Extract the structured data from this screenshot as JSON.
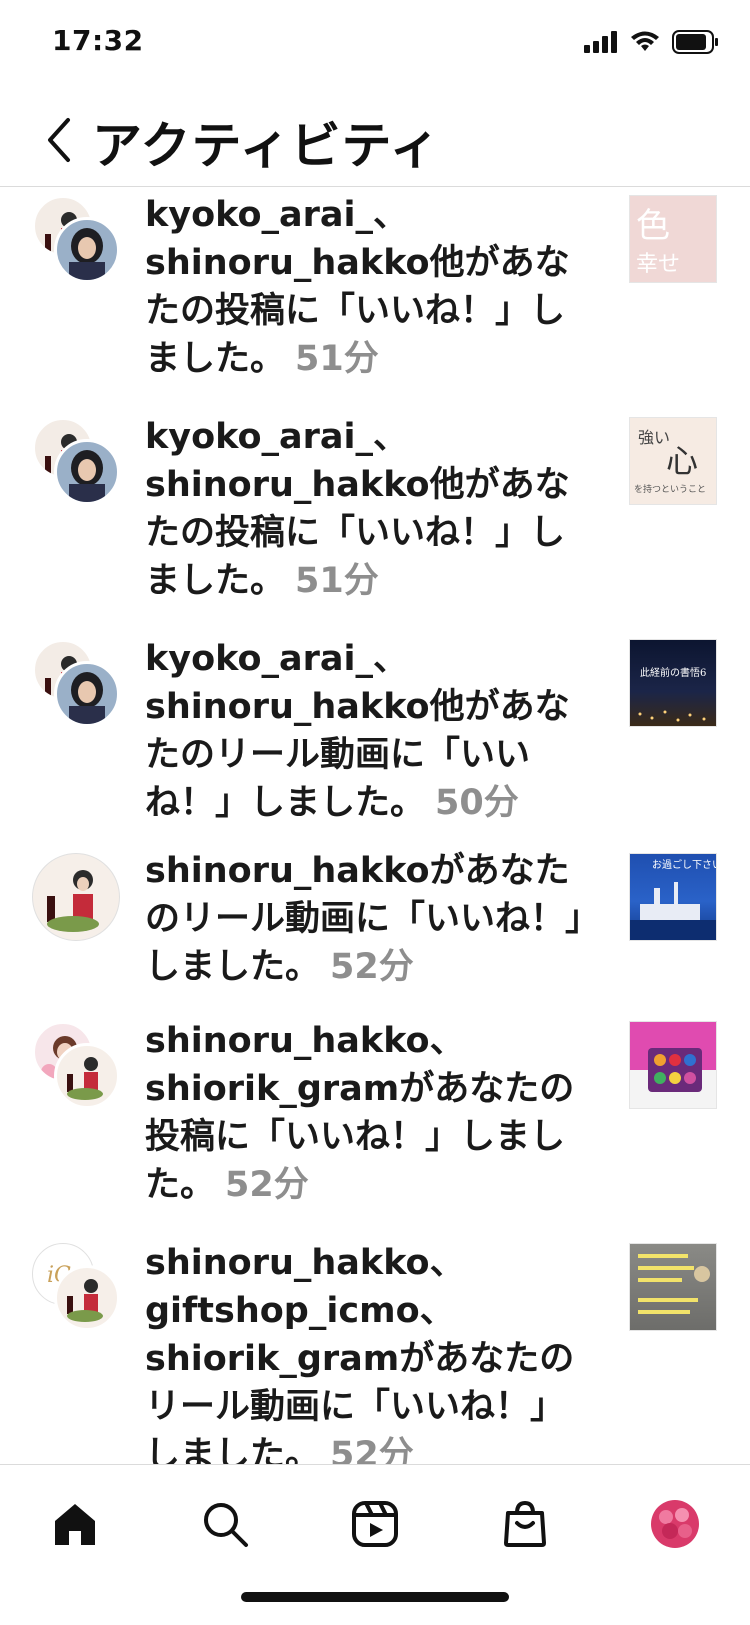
{
  "status": {
    "time": "17:32"
  },
  "header": {
    "title": "アクティビティ",
    "back_icon": "chevron-left-icon"
  },
  "notifications": [
    {
      "usernames": "kyoko_arai_、 shinoru_hakko",
      "message": "他があなたの投稿に「いいね！」しました。",
      "time": "51分",
      "thumb": {
        "line1": "色",
        "line2": "幸せ"
      }
    },
    {
      "usernames": "kyoko_arai_、 shinoru_hakko",
      "message": "他があなたの投稿に「いいね！」しました。",
      "time": "51分",
      "thumb": {
        "line1": "強い",
        "line2": "心",
        "line3": "を持つということ"
      }
    },
    {
      "usernames": "kyoko_arai_、 shinoru_hakko",
      "message": "他があなたのリール動画に「いいね！」しました。",
      "time": "50分",
      "thumb": {
        "line1": "此経前の書悟6"
      }
    },
    {
      "usernames": "shinoru_hakko",
      "message": "があなたのリール動画に「いいね！」しました。",
      "time": "52分",
      "thumb": {
        "line1": "お過ごし下さい"
      }
    },
    {
      "usernames": "shinoru_hakko、 shiorik_gram",
      "message": "があなたの投稿に「いいね！」しました。",
      "time": "52分",
      "thumb": {}
    },
    {
      "usernames": "shinoru_hakko、 giftshop_icmo、 shiorik_gram",
      "message": "があなたのリール動画に「いいね！」しました。",
      "time": "52分",
      "thumb": {}
    }
  ],
  "tab_bar": {
    "items": [
      "home-icon",
      "search-icon",
      "reels-icon",
      "shop-icon",
      "profile-avatar"
    ]
  },
  "colors": {
    "accent_time": "#8e8e8e",
    "divider": "#dbdbdb"
  }
}
